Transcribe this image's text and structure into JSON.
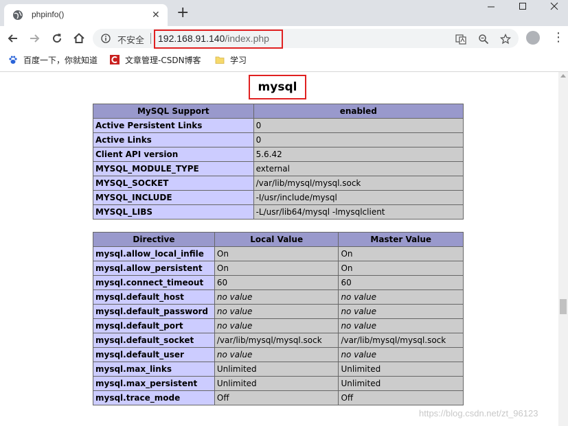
{
  "browser": {
    "tab": {
      "title": "phpinfo()"
    },
    "address_bar": {
      "security_label": "不安全",
      "url_host": "192.168.91.140",
      "url_path": "/index.php"
    },
    "bookmarks": [
      {
        "label": "百度一下，你就知道",
        "icon": "baidu-paw-icon"
      },
      {
        "label": "文章管理-CSDN博客",
        "icon": "csdn-icon"
      },
      {
        "label": "学习",
        "icon": "folder-icon"
      }
    ]
  },
  "page": {
    "heading": "mysql",
    "support_table": {
      "headers": [
        "MySQL Support",
        "enabled"
      ],
      "rows": [
        {
          "name": "Active Persistent Links",
          "value": "0"
        },
        {
          "name": "Active Links",
          "value": "0"
        },
        {
          "name": "Client API version",
          "value": "5.6.42"
        },
        {
          "name": "MYSQL_MODULE_TYPE",
          "value": "external"
        },
        {
          "name": "MYSQL_SOCKET",
          "value": "/var/lib/mysql/mysql.sock"
        },
        {
          "name": "MYSQL_INCLUDE",
          "value": "-I/usr/include/mysql"
        },
        {
          "name": "MYSQL_LIBS",
          "value": "-L/usr/lib64/mysql -lmysqlclient"
        }
      ]
    },
    "directive_table": {
      "headers": [
        "Directive",
        "Local Value",
        "Master Value"
      ],
      "rows": [
        {
          "name": "mysql.allow_local_infile",
          "local": "On",
          "master": "On"
        },
        {
          "name": "mysql.allow_persistent",
          "local": "On",
          "master": "On"
        },
        {
          "name": "mysql.connect_timeout",
          "local": "60",
          "master": "60"
        },
        {
          "name": "mysql.default_host",
          "local": "no value",
          "master": "no value"
        },
        {
          "name": "mysql.default_password",
          "local": "no value",
          "master": "no value"
        },
        {
          "name": "mysql.default_port",
          "local": "no value",
          "master": "no value"
        },
        {
          "name": "mysql.default_socket",
          "local": "/var/lib/mysql/mysql.sock",
          "master": "/var/lib/mysql/mysql.sock"
        },
        {
          "name": "mysql.default_user",
          "local": "no value",
          "master": "no value"
        },
        {
          "name": "mysql.max_links",
          "local": "Unlimited",
          "master": "Unlimited"
        },
        {
          "name": "mysql.max_persistent",
          "local": "Unlimited",
          "master": "Unlimited"
        },
        {
          "name": "mysql.trace_mode",
          "local": "Off",
          "master": "Off"
        }
      ]
    }
  },
  "watermark": "https://blog.csdn.net/zt_96123",
  "colors": {
    "header_bg": "#9999cc",
    "key_bg": "#ccccff",
    "value_bg": "#cccccc",
    "highlight_border": "#e02020"
  }
}
